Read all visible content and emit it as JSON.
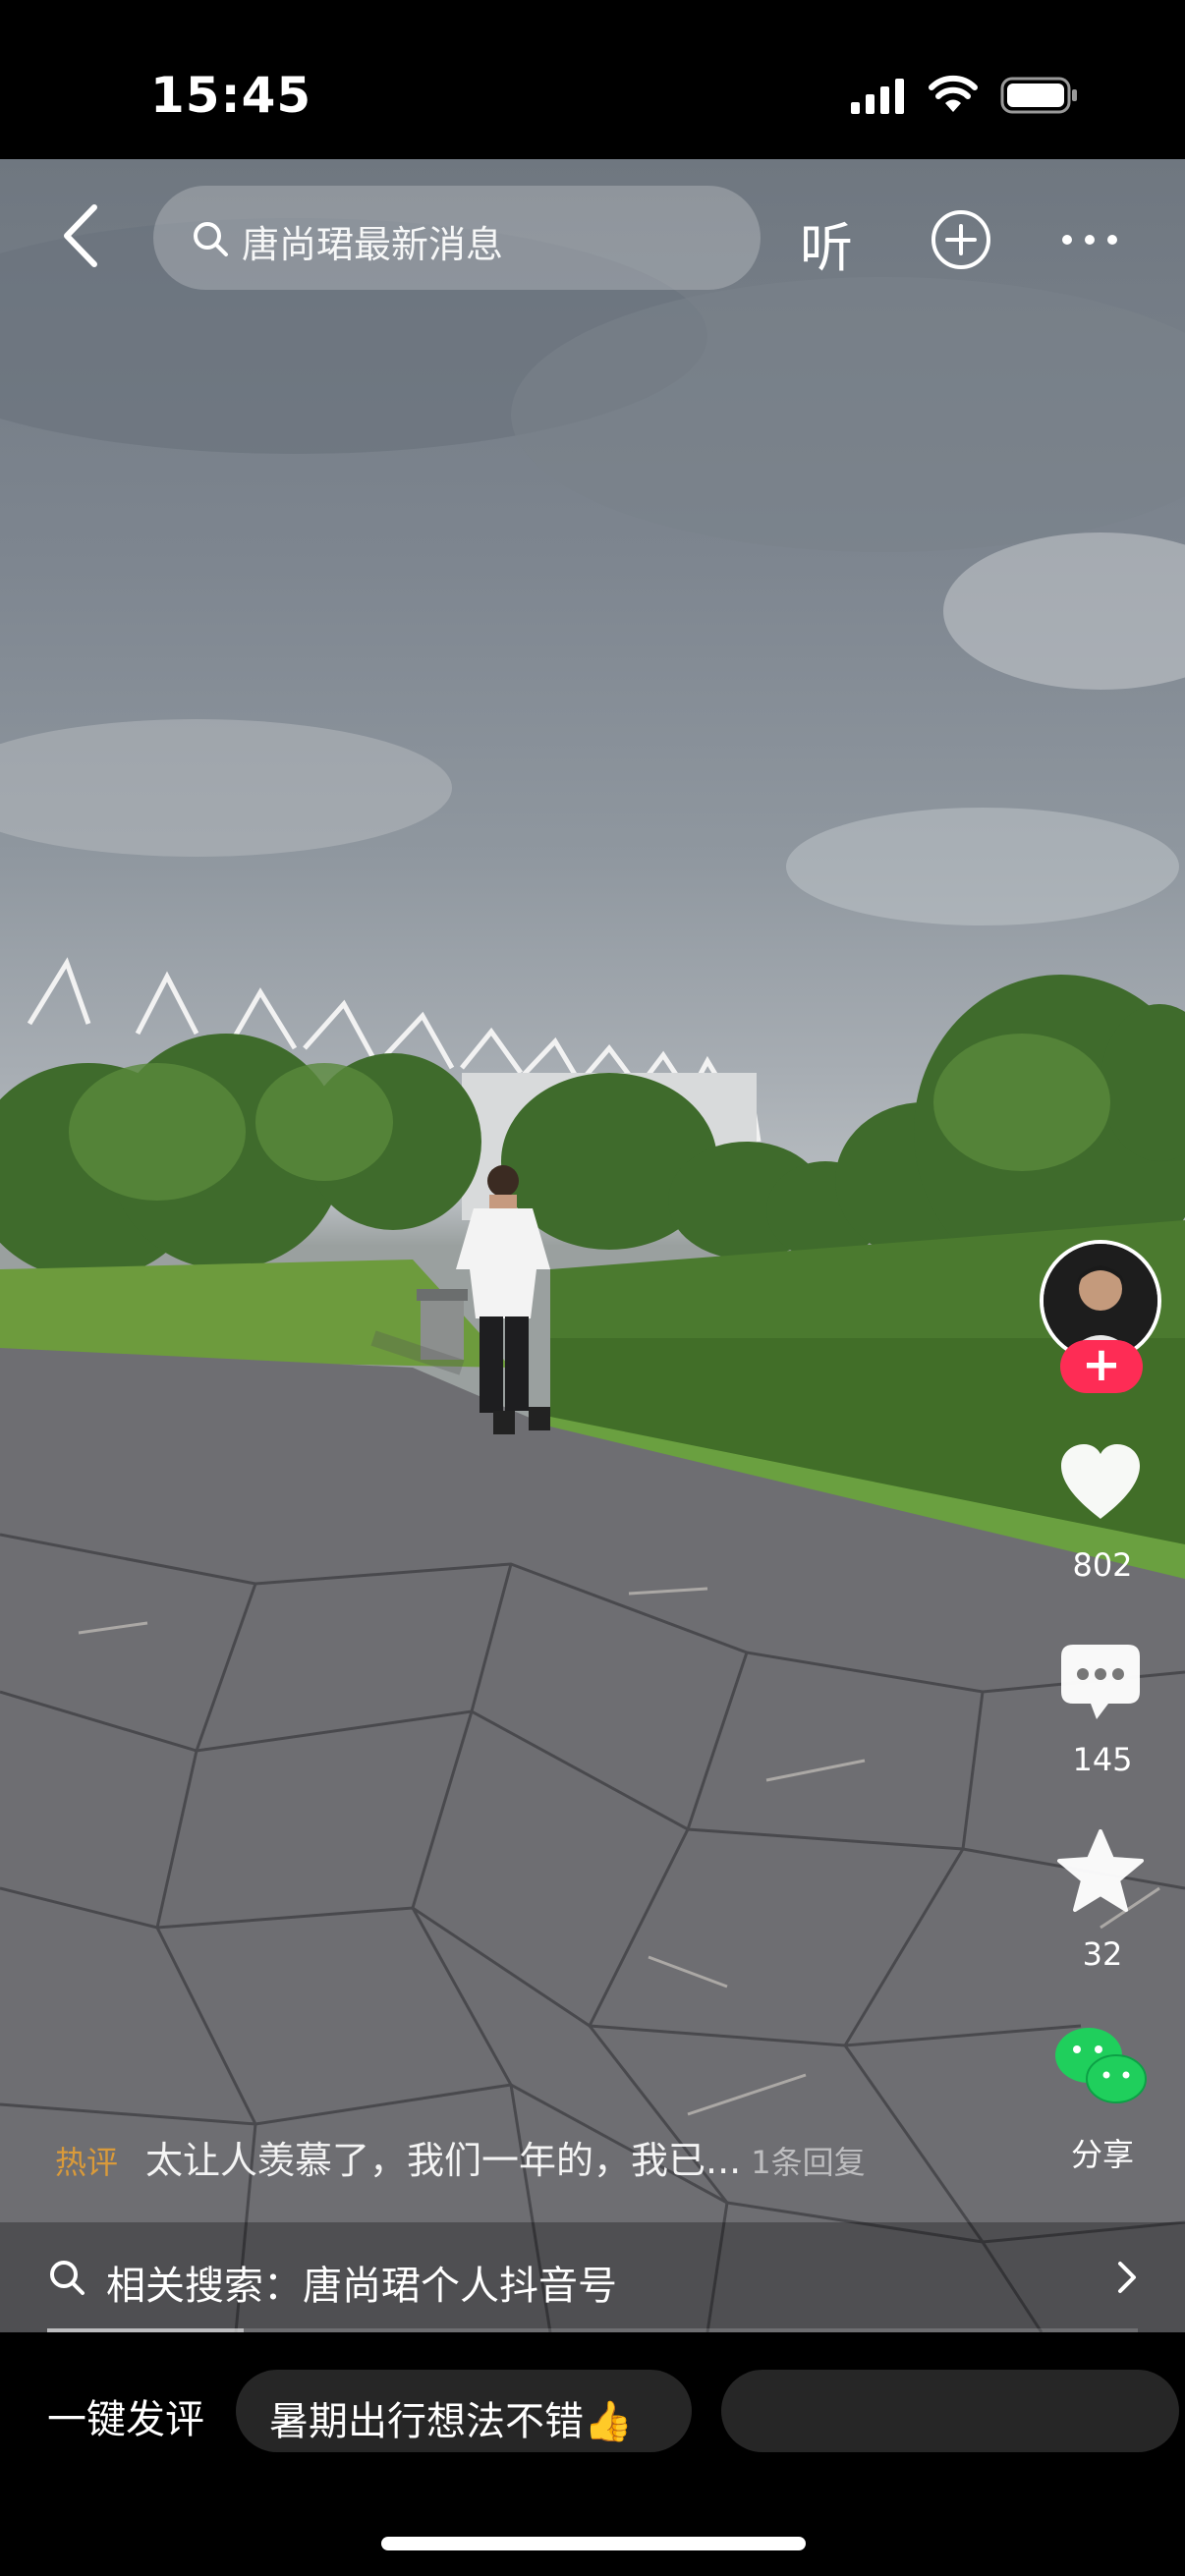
{
  "status_bar": {
    "time": "15:45"
  },
  "top_bar": {
    "search_text": "唐尚珺最新消息",
    "listen_label": "听"
  },
  "right_rail": {
    "likes": "802",
    "comments": "145",
    "favorites": "32",
    "share_label": "分享"
  },
  "hot_comment": {
    "tag": "热评",
    "text": "太让人羡慕了，我们一年的，我已...",
    "replies": "1条回复"
  },
  "related_search": {
    "label": "相关搜索：唐尚珺个人抖音号"
  },
  "video_progress": 0.18,
  "bottom_bar": {
    "one_key_comment": "一键发评",
    "suggestion_chip": "暑期出行想法不错👍"
  },
  "colors": {
    "accent_red": "#fe2c55",
    "hot_tag": "#d99a3a",
    "wechat_green": "#1fcf5c"
  },
  "icons": [
    "back-icon",
    "search-icon",
    "plus-circle-icon",
    "more-icon",
    "heart-icon",
    "comment-icon",
    "star-icon",
    "wechat-icon",
    "chevron-right-icon"
  ]
}
